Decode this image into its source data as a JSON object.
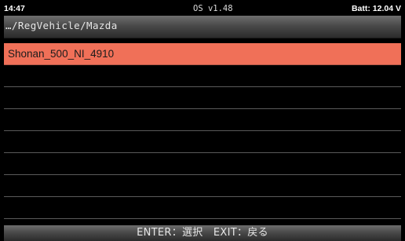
{
  "status": {
    "time": "14:47",
    "os_version": "OS v1.48",
    "battery": "Batt: 12.04 V"
  },
  "breadcrumb": {
    "path": "…/RegVehicle/Mazda"
  },
  "list": {
    "items": [
      {
        "label": "Shonan_500_NI_4910",
        "selected": true
      },
      {
        "label": "",
        "selected": false
      },
      {
        "label": "",
        "selected": false
      },
      {
        "label": "",
        "selected": false
      },
      {
        "label": "",
        "selected": false
      },
      {
        "label": "",
        "selected": false
      },
      {
        "label": "",
        "selected": false
      },
      {
        "label": "",
        "selected": false
      }
    ]
  },
  "footer": {
    "hint": "ENTER：選択　EXIT：戻る"
  },
  "colors": {
    "selection": "#f07058",
    "background": "#000000",
    "bar_gradient_top": "#6e6e6e",
    "bar_gradient_bottom": "#2b2b2b"
  }
}
